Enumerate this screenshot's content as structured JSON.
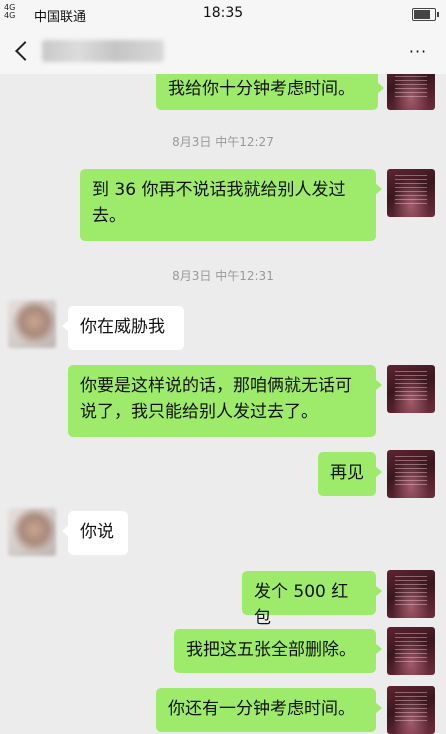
{
  "status_bar": {
    "signal": "4G\n4G",
    "carrier": "中国联通",
    "time": "18:35"
  },
  "nav": {
    "more_label": "···"
  },
  "messages": [
    {
      "id": "m1",
      "side": "right",
      "text": "我给你十分钟考虑时间。"
    },
    {
      "id": "t1",
      "type": "timestamp",
      "text": "8月3日 中午12:27"
    },
    {
      "id": "m2",
      "side": "right",
      "text": "到 36 你再不说话我就给别人发过去。"
    },
    {
      "id": "t2",
      "type": "timestamp",
      "text": "8月3日 中午12:31"
    },
    {
      "id": "m3",
      "side": "left",
      "text": "你在威胁我"
    },
    {
      "id": "m4",
      "side": "right",
      "text": "你要是这样说的话，那咱俩就无话可说了，我只能给别人发过去了。"
    },
    {
      "id": "m5",
      "side": "right",
      "text": "再见"
    },
    {
      "id": "m6",
      "side": "left",
      "text": "你说"
    },
    {
      "id": "m7",
      "side": "right",
      "text": "发个 500 红包"
    },
    {
      "id": "m8",
      "side": "right",
      "text": "我把这五张全部删除。"
    },
    {
      "id": "m9",
      "side": "right",
      "text": "你还有一分钟考虑时间。"
    }
  ],
  "colors": {
    "my_bubble": "#9eea6a",
    "their_bubble": "#ffffff",
    "background": "#ececec",
    "timestamp_text": "#999999"
  }
}
